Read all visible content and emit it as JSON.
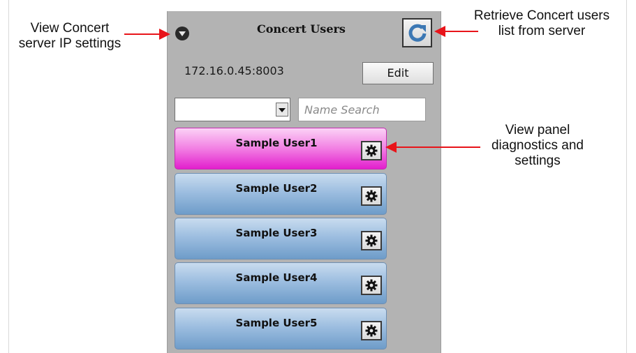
{
  "annotations": {
    "ip_settings": [
      "View Concert",
      "server IP settings"
    ],
    "retrieve": [
      "Retrieve Concert users",
      "list from server"
    ],
    "diagnostics": [
      "View panel",
      "diagnostics and",
      "settings"
    ]
  },
  "panel": {
    "title": "Concert Users",
    "server_address": "172.16.0.45:8003",
    "edit_label": "Edit",
    "filter_value": "",
    "search_placeholder": "Name Search",
    "refresh_icon": "refresh-icon",
    "collapse_icon": "chevron-down-icon"
  },
  "users": [
    {
      "name": "Sample User1",
      "selected": true
    },
    {
      "name": "Sample User2",
      "selected": false
    },
    {
      "name": "Sample User3",
      "selected": false
    },
    {
      "name": "Sample User4",
      "selected": false
    },
    {
      "name": "Sample User5",
      "selected": false
    }
  ],
  "colors": {
    "arrow": "#e8141a",
    "selected_row": "#e93bd3",
    "normal_row": "#8fb3d9",
    "panel_bg": "#b3b3b3",
    "refresh_icon": "#3c78b4"
  }
}
